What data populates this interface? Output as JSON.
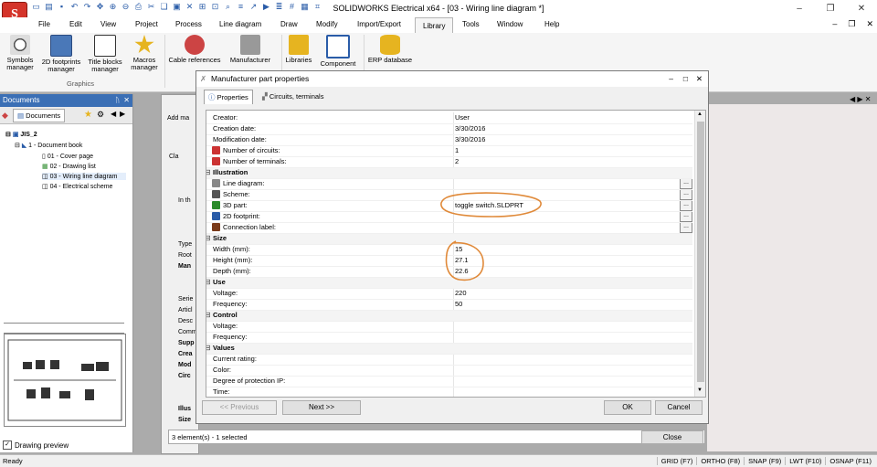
{
  "window": {
    "title": "SOLIDWORKS Electrical x64 - [03 - Wiring line diagram *]",
    "controls": {
      "minimize": "–",
      "restore": "❐",
      "close": "✕"
    },
    "mdi_controls": {
      "minimize": "–",
      "restore": "❐",
      "close": "✕"
    }
  },
  "menu": {
    "items": [
      "File",
      "Edit",
      "View",
      "Project",
      "Process",
      "Line diagram",
      "Draw",
      "Modify",
      "Import/Export",
      "Library",
      "Tools",
      "Window",
      "Help"
    ],
    "active": "Library"
  },
  "ribbon": {
    "buttons": [
      {
        "label": "Symbols\nmanager"
      },
      {
        "label": "2D footprints\nmanager"
      },
      {
        "label": "Title blocks\nmanager"
      },
      {
        "label": "Macros\nmanager"
      },
      {
        "label": "Cable references"
      },
      {
        "label": "Manufacturer"
      },
      {
        "label": "Libraries"
      },
      {
        "label": "Component"
      },
      {
        "label": "ERP database"
      }
    ],
    "group_label": "Graphics"
  },
  "documents_panel": {
    "title": "Documents",
    "pin": "📌",
    "close": "✕",
    "tab": "Documents",
    "tree": [
      {
        "label": "JIS_2",
        "level": 0
      },
      {
        "label": "1 - Document book",
        "level": 1
      },
      {
        "label": "01 - Cover page",
        "level": 2
      },
      {
        "label": "02 - Drawing list",
        "level": 2
      },
      {
        "label": "03 - Wiring line diagram",
        "level": 2
      },
      {
        "label": "04 - Electrical scheme",
        "level": 2
      }
    ],
    "preview_checkbox": "Drawing preview",
    "preview_checked": true
  },
  "background_panel": {
    "fragments": [
      "Add ma",
      "Cla",
      "In th",
      "Type",
      "Root",
      "Man",
      "Serie",
      "Articl",
      "Desc",
      "Comm",
      "Supp",
      "Crea",
      "Mod",
      "Circ",
      "Illus",
      "Size"
    ]
  },
  "dialog": {
    "title": "Manufacturer part properties",
    "minimize": "–",
    "maximize": "□",
    "close": "✕",
    "tabs": [
      "Properties",
      "Circuits, terminals"
    ],
    "active_tab": "Properties",
    "rows": [
      {
        "type": "prop",
        "key": "Creator:",
        "value": "User"
      },
      {
        "type": "prop",
        "key": "Creation date:",
        "value": "3/30/2016"
      },
      {
        "type": "prop",
        "key": "Modification date:",
        "value": "3/30/2016"
      },
      {
        "type": "prop",
        "key": "Number of circuits:",
        "value": "1",
        "icon": "circuits-icon"
      },
      {
        "type": "prop",
        "key": "Number of terminals:",
        "value": "2",
        "icon": "terminals-icon"
      },
      {
        "type": "cat",
        "key": "Illustration"
      },
      {
        "type": "prop",
        "key": "Line diagram:",
        "value": "",
        "icon": "line-diagram-icon",
        "ellipsis": true
      },
      {
        "type": "prop",
        "key": "Scheme:",
        "value": "",
        "icon": "scheme-icon",
        "ellipsis": true
      },
      {
        "type": "prop",
        "key": "3D part:",
        "value": "toggle switch.SLDPRT",
        "icon": "3d-part-icon",
        "ellipsis": true
      },
      {
        "type": "prop",
        "key": "2D footprint:",
        "value": "",
        "icon": "2d-footprint-icon",
        "ellipsis": true
      },
      {
        "type": "prop",
        "key": "Connection label:",
        "value": "",
        "icon": "connection-label-icon",
        "ellipsis": true
      },
      {
        "type": "cat",
        "key": "Size"
      },
      {
        "type": "prop",
        "key": "Width (mm):",
        "value": "15"
      },
      {
        "type": "prop",
        "key": "Height (mm):",
        "value": "27.1"
      },
      {
        "type": "prop",
        "key": "Depth (mm):",
        "value": "22.6"
      },
      {
        "type": "cat",
        "key": "Use"
      },
      {
        "type": "prop",
        "key": "Voltage:",
        "value": "220"
      },
      {
        "type": "prop",
        "key": "Frequency:",
        "value": "50"
      },
      {
        "type": "cat",
        "key": "Control"
      },
      {
        "type": "prop",
        "key": "Voltage:",
        "value": ""
      },
      {
        "type": "prop",
        "key": "Frequency:",
        "value": ""
      },
      {
        "type": "cat",
        "key": "Values"
      },
      {
        "type": "prop",
        "key": "Current rating:",
        "value": ""
      },
      {
        "type": "prop",
        "key": "Color:",
        "value": ""
      },
      {
        "type": "prop",
        "key": "Degree of protection IP:",
        "value": ""
      },
      {
        "type": "prop",
        "key": "Time:",
        "value": ""
      }
    ],
    "buttons": {
      "previous": "<< Previous",
      "next": "Next >>",
      "ok": "OK",
      "cancel": "Cancel"
    }
  },
  "selection_footer": {
    "text": "3 element(s) - 1 selected",
    "close": "Close"
  },
  "statusbar": {
    "left": "Ready",
    "right": [
      "GRID (F7)",
      "ORTHO (F8)",
      "SNAP (F9)",
      "LWT (F10)",
      "OSNAP (F11)"
    ]
  },
  "colors": {
    "panel_title": "#3b6fb5",
    "annotation": "#e08a3a",
    "app_icon": "#d4342a"
  }
}
